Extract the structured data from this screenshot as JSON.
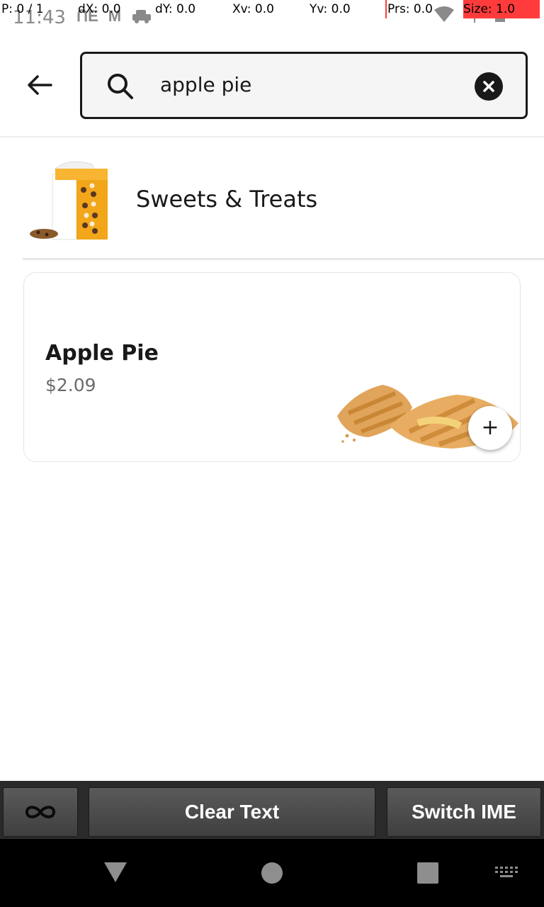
{
  "status_bar": {
    "time": "11:43",
    "left_icons": [
      "ue-icon",
      "gmail-icon",
      "car-icon"
    ],
    "right_icons": [
      "wifi-icon",
      "signal-icon",
      "battery-icon"
    ]
  },
  "pointer_overlay": {
    "p": "P: 0 / 1",
    "dx": "dX: 0.0",
    "dy": "dY: 0.0",
    "xv": "Xv: 0.0",
    "yv": "Yv: 0.0",
    "prs": "Prs: 0.0",
    "size": "Size: 1.0"
  },
  "header": {
    "search_value": "apple pie",
    "search_placeholder": "",
    "back_icon": "arrow-left-icon",
    "clear_icon": "close-circle-icon"
  },
  "category": {
    "title": "Sweets & Treats"
  },
  "item": {
    "name": "Apple Pie",
    "price": "$2.09",
    "add_label": "+"
  },
  "ime_bar": {
    "infinity_icon": "infinity-icon",
    "clear_text": "Clear Text",
    "switch_ime": "Switch IME"
  },
  "nav_bar": {
    "icons": [
      "back-triangle-icon",
      "home-circle-icon",
      "recents-square-icon",
      "keyboard-icon"
    ]
  },
  "colors": {
    "text_primary": "#191919",
    "text_secondary": "#6b6b6b",
    "search_bg": "#f5f5f5",
    "overlay_red": "#ff3b3b"
  }
}
